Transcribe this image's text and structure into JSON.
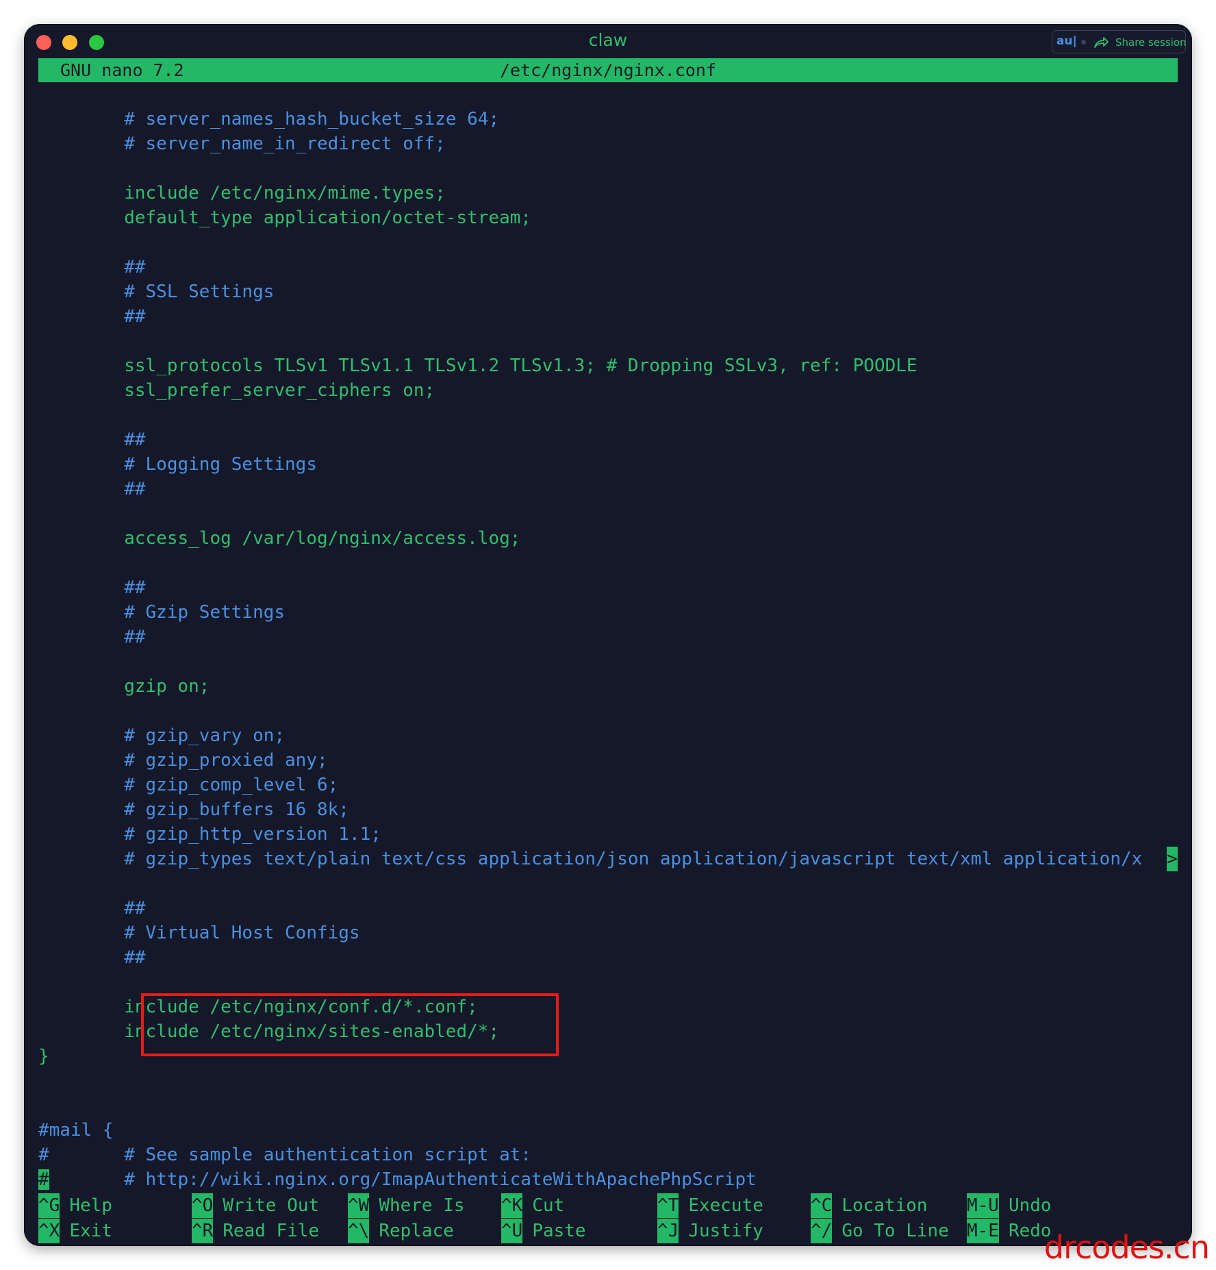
{
  "window": {
    "title": "claw",
    "share": {
      "au_label": "au|",
      "label": "Share session"
    }
  },
  "nano": {
    "program": "GNU nano 7.2",
    "filename": "/etc/nginx/nginx.conf"
  },
  "editor": {
    "lines": [
      "        # server_names_hash_bucket_size 64;",
      "        # server_name_in_redirect off;",
      "",
      "        include /etc/nginx/mime.types;",
      "        default_type application/octet-stream;",
      "",
      "        ##",
      "        # SSL Settings",
      "        ##",
      "",
      "        ssl_protocols TLSv1 TLSv1.1 TLSv1.2 TLSv1.3; # Dropping SSLv3, ref: POODLE",
      "        ssl_prefer_server_ciphers on;",
      "",
      "        ##",
      "        # Logging Settings",
      "        ##",
      "",
      "        access_log /var/log/nginx/access.log;",
      "",
      "        ##",
      "        # Gzip Settings",
      "        ##",
      "",
      "        gzip on;",
      "",
      "        # gzip_vary on;",
      "        # gzip_proxied any;",
      "        # gzip_comp_level 6;",
      "        # gzip_buffers 16 8k;",
      "        # gzip_http_version 1.1;",
      "        # gzip_types text/plain text/css application/json application/javascript text/xml application/x",
      "",
      "        ##",
      "        # Virtual Host Configs",
      "        ##",
      "",
      "        include /etc/nginx/conf.d/*.conf;",
      "        include /etc/nginx/sites-enabled/*;",
      "}",
      "",
      "",
      "#mail {",
      "#       # See sample authentication script at:",
      "#       # http://wiki.nginx.org/ImapAuthenticateWithApachePhpScript"
    ],
    "overflow_marker": ">"
  },
  "shortcuts": [
    {
      "key": "^G",
      "label": "Help"
    },
    {
      "key": "^X",
      "label": "Exit"
    },
    {
      "key": "^O",
      "label": "Write Out"
    },
    {
      "key": "^R",
      "label": "Read File"
    },
    {
      "key": "^W",
      "label": "Where Is"
    },
    {
      "key": "^\\",
      "label": "Replace"
    },
    {
      "key": "^K",
      "label": "Cut"
    },
    {
      "key": "^U",
      "label": "Paste"
    },
    {
      "key": "^T",
      "label": "Execute"
    },
    {
      "key": "^J",
      "label": "Justify"
    },
    {
      "key": "^C",
      "label": "Location"
    },
    {
      "key": "^/",
      "label": "Go To Line"
    },
    {
      "key": "M-U",
      "label": "Undo"
    },
    {
      "key": "M-E",
      "label": "Redo"
    }
  ],
  "watermark": "drcodes.cn",
  "colors": {
    "background": "#141828",
    "code_green": "#2fbf6f",
    "comment_blue": "#4a90e2",
    "bar_green": "#23b865",
    "highlight_red": "#e51c1c"
  }
}
